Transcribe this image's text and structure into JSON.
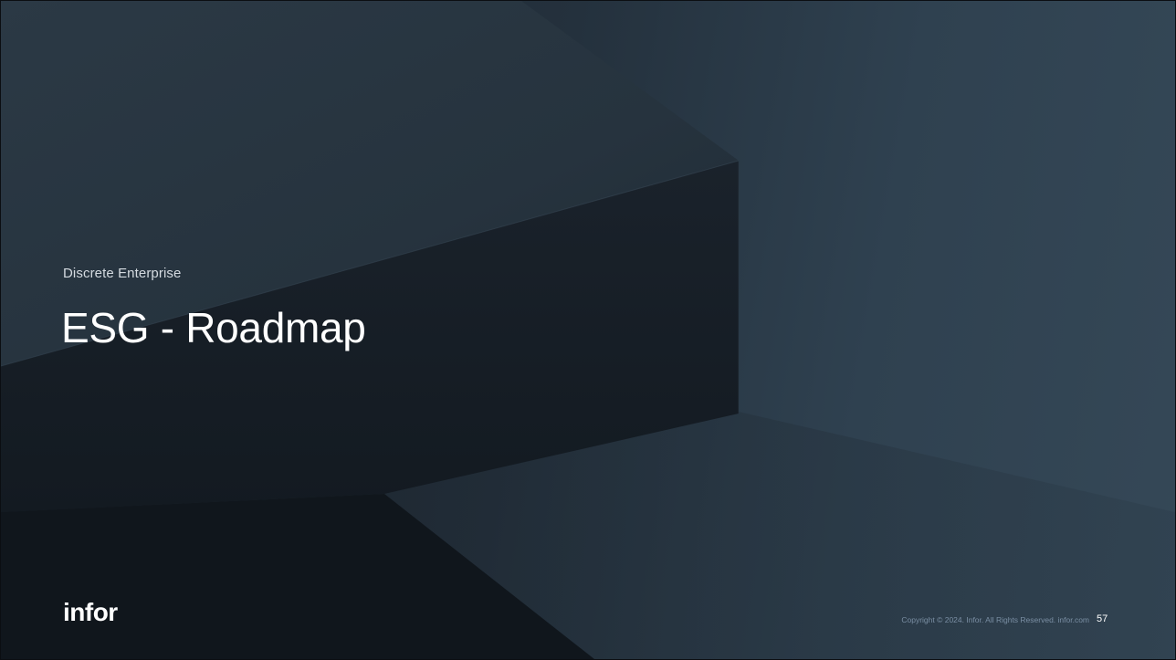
{
  "slide": {
    "eyebrow": "Discrete Enterprise",
    "title": "ESG - Roadmap",
    "logo": "infor",
    "copyright": "Copyright © 2024. Infor. All Rights Reserved. infor.com",
    "page_number": "57"
  },
  "colors": {
    "background_dark": "#1b232c",
    "background_light": "#354857",
    "title": "#ffffff",
    "eyebrow": "#d4dae0",
    "copyright": "#7a8ea3"
  }
}
